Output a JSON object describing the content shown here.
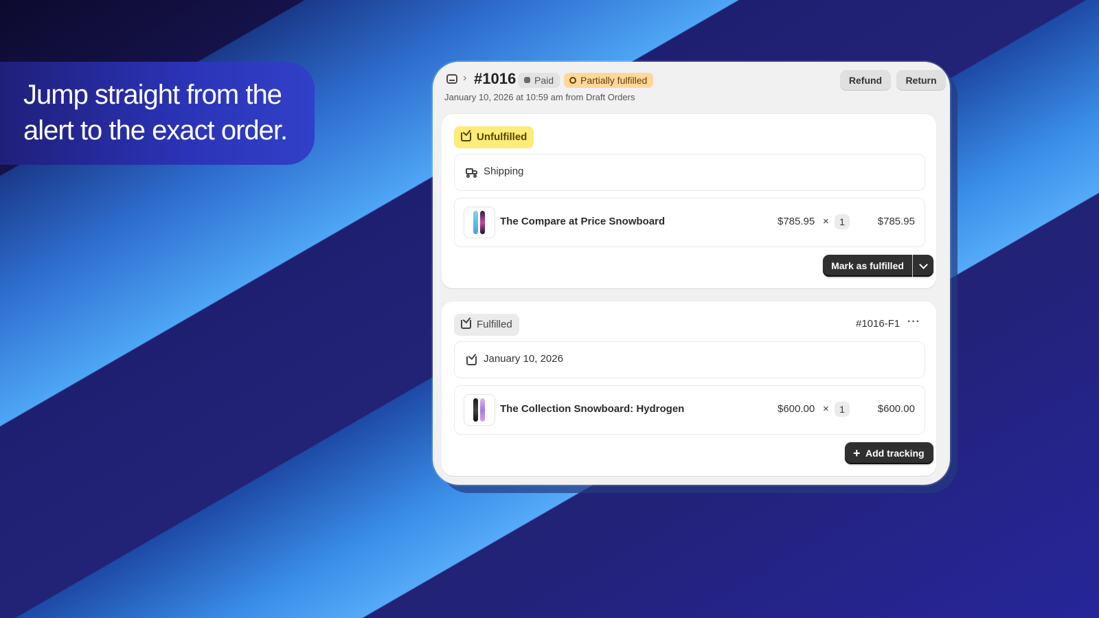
{
  "headline": {
    "line1": "Jump straight from the",
    "line2": "alert to the exact order."
  },
  "order": {
    "number": "#1016",
    "badges": {
      "paid": "Paid",
      "partial": "Partially fulfilled"
    },
    "actions": {
      "refund": "Refund",
      "return": "Return"
    },
    "subtitle": "January 10, 2026 at 10:59 am from Draft Orders"
  },
  "unfulfilled": {
    "status": "Unfulfilled",
    "method": "Shipping",
    "item": {
      "name": "The Compare at Price Snowboard",
      "unit_price": "$785.95",
      "times": "×",
      "qty": "1",
      "total": "$785.95"
    },
    "action": "Mark as fulfilled"
  },
  "fulfilled": {
    "status": "Fulfilled",
    "id": "#1016-F1",
    "more": "···",
    "date": "January 10, 2026",
    "item": {
      "name": "The Collection Snowboard: Hydrogen",
      "unit_price": "$600.00",
      "times": "×",
      "qty": "1",
      "total": "$600.00"
    },
    "action": "Add tracking"
  },
  "colors": {
    "unfulfilled_badge": "#ffeb78",
    "partial_badge": "#ffd79d",
    "primary_button": "#303030"
  },
  "icons": [
    "order-icon",
    "truck-icon",
    "fulfillment-icon",
    "more-icon",
    "chevron-down-icon",
    "plus-icon"
  ]
}
